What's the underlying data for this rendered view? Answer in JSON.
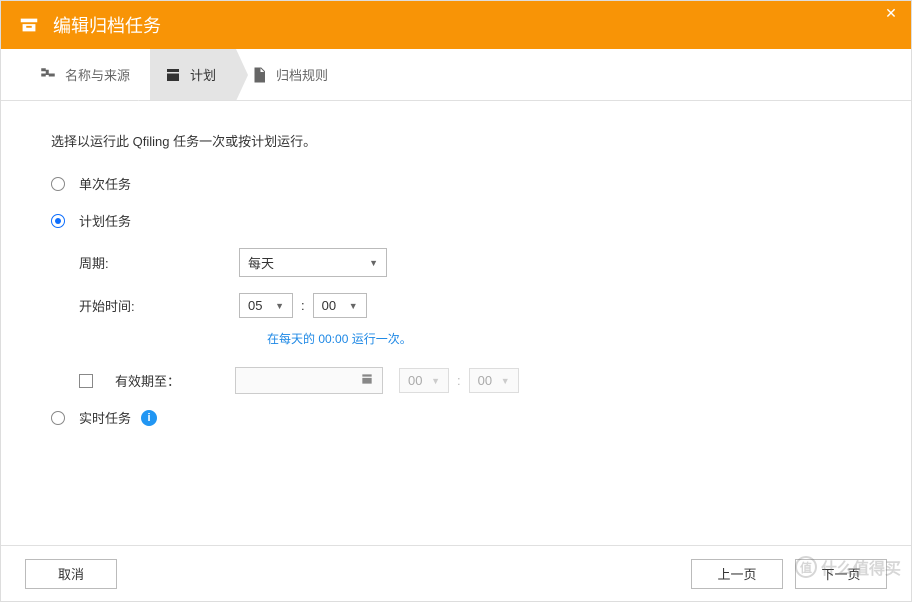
{
  "header": {
    "title": "编辑归档任务"
  },
  "steps": {
    "items": [
      {
        "label": "名称与来源"
      },
      {
        "label": "计划"
      },
      {
        "label": "归档规则"
      }
    ],
    "active_index": 1
  },
  "content": {
    "instruction": "选择以运行此 Qfiling 任务一次或按计划运行。",
    "options": {
      "single": "单次任务",
      "scheduled": "计划任务",
      "realtime": "实时任务"
    },
    "selected_option": "scheduled",
    "schedule": {
      "period_label": "周期:",
      "period_value": "每天",
      "start_label": "开始时间:",
      "start_hour": "05",
      "start_minute": "00",
      "hint": "在每天的 00:00 运行一次。",
      "expire_checked": false,
      "expire_label": "有效期至：",
      "expire_date": "",
      "expire_hour": "00",
      "expire_minute": "00"
    }
  },
  "footer": {
    "cancel": "取消",
    "prev": "上一页",
    "next": "下一页"
  },
  "watermark": "什么值得买"
}
